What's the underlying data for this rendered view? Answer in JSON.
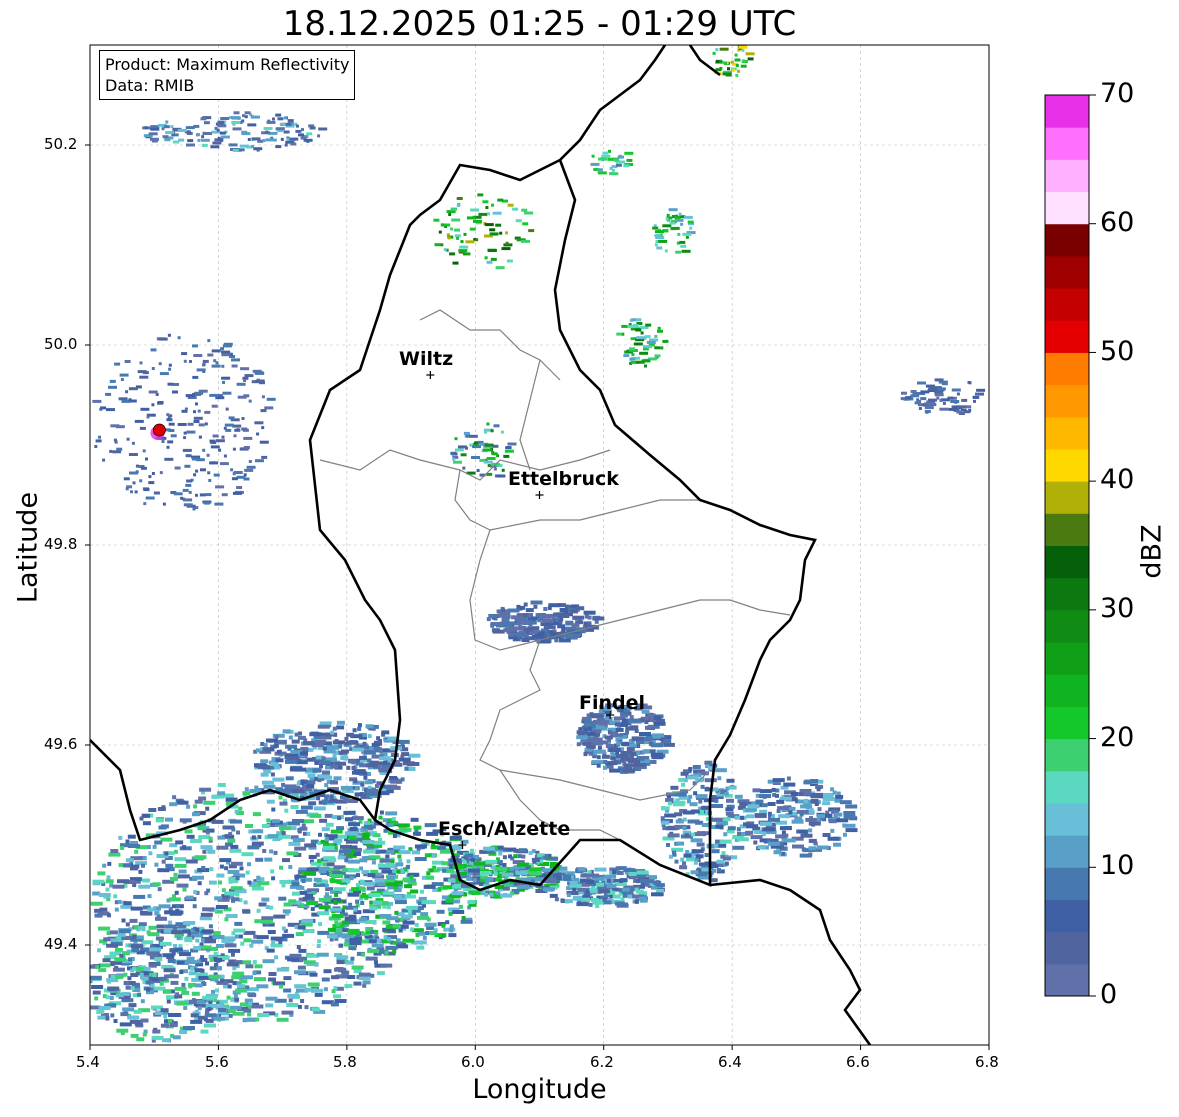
{
  "title": "18.12.2025 01:25 - 01:29 UTC",
  "info": {
    "product": "Product: Maximum Reflectivity",
    "data_source": "Data: RMIB"
  },
  "axes": {
    "xlabel": "Longitude",
    "ylabel": "Latitude",
    "xlim": [
      5.4,
      6.8
    ],
    "ylim": [
      49.3,
      50.3
    ],
    "xticks": [
      "5.4",
      "5.6",
      "5.8",
      "6.0",
      "6.2",
      "6.4",
      "6.6",
      "6.8"
    ],
    "yticks": [
      "49.4",
      "49.6",
      "49.8",
      "50.0",
      "50.2"
    ],
    "grid": true
  },
  "colorbar": {
    "label": "dBZ",
    "ticks": [
      "0",
      "10",
      "20",
      "30",
      "40",
      "50",
      "60",
      "70"
    ],
    "colors": [
      "#6070a8",
      "#5064a0",
      "#4060a6",
      "#4878b0",
      "#58a0c8",
      "#68c0d8",
      "#5ad8c0",
      "#3cd070",
      "#14c82c",
      "#10b420",
      "#10a018",
      "#108c14",
      "#0c7810",
      "#06600a",
      "#4a7a10",
      "#b0b008",
      "#ffd800",
      "#ffb800",
      "#ff9800",
      "#ff7c00",
      "#e40000",
      "#c40000",
      "#a00000",
      "#780000",
      "#ffe0ff",
      "#ffb0ff",
      "#ff70ff",
      "#e830e8"
    ]
  },
  "cities": [
    {
      "name": "Wiltz",
      "lon": 5.93,
      "lat": 49.97
    },
    {
      "name": "Ettelbruck",
      "lon": 6.1,
      "lat": 49.85
    },
    {
      "name": "Findel",
      "lon": 6.21,
      "lat": 49.63
    },
    {
      "name": "Esch/Alzette",
      "lon": 5.98,
      "lat": 49.5
    }
  ],
  "radar_site": {
    "lon": 5.505,
    "lat": 49.915
  },
  "colors": {
    "border": "#000000",
    "district": "#808080",
    "grid": "#bbbbbb"
  }
}
